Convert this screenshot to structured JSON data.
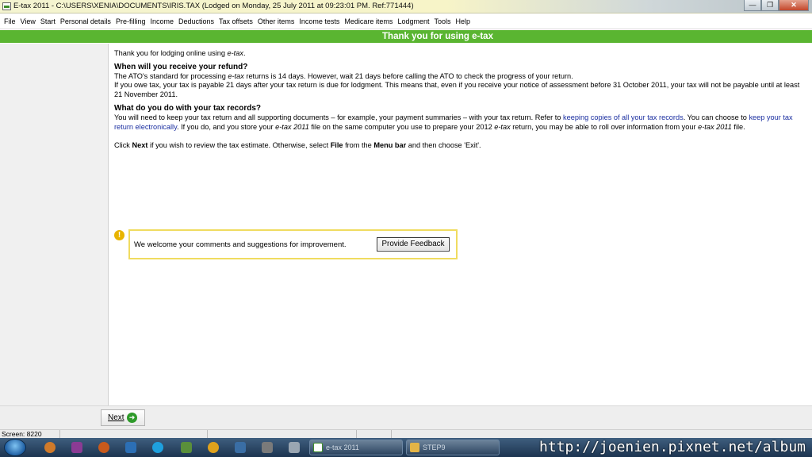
{
  "window": {
    "title": "E-tax 2011 - C:\\USERS\\XENIA\\DOCUMENTS\\IRIS.TAX (Lodged on Monday, 25 July 2011 at 09:23:01 PM.  Ref:771444)",
    "minimize_glyph": "—",
    "maximize_glyph": "❐",
    "close_glyph": "✕"
  },
  "menu": {
    "items": [
      {
        "label": "File"
      },
      {
        "label": "View"
      },
      {
        "label": "Start"
      },
      {
        "label": "Personal details"
      },
      {
        "label": "Pre-filling"
      },
      {
        "label": "Income"
      },
      {
        "label": "Deductions"
      },
      {
        "label": "Tax offsets"
      },
      {
        "label": "Other items"
      },
      {
        "label": "Income tests"
      },
      {
        "label": "Medicare items"
      },
      {
        "label": "Lodgment"
      },
      {
        "label": "Tools"
      },
      {
        "label": "Help"
      }
    ]
  },
  "header": {
    "title": "Thank you for using e-tax",
    "color": "#5ab531"
  },
  "content": {
    "intro_before": "Thank you for lodging online using ",
    "intro_em": "e-tax",
    "intro_after": ".",
    "refund_heading": "When will you receive your refund?",
    "refund_p1_before": "The ATO's standard for processing ",
    "refund_p1_em": "e-tax",
    "refund_p1_after": " returns is 14 days. However, wait 21 days before calling the ATO to check the progress of your return.",
    "refund_p2": "If you owe tax, your tax is payable 21 days after your tax return is due for lodgment. This means that, even if you receive your notice of assessment before 31 October 2011, your tax will not be payable until at least 21 November 2011.",
    "records_heading": "What do you do with your tax records?",
    "records_p_1": "You will need to keep your tax return and all supporting documents – for example, your payment summaries – with your tax return. Refer to ",
    "records_link_1": "keeping copies of all your tax records",
    "records_p_2": ". You can choose to ",
    "records_link_2": "keep your tax return electronically",
    "records_p_3": ". If you do, and you store your ",
    "records_em_1": "e-tax 2011",
    "records_p_4": " file on the same computer you use to prepare your 2012 ",
    "records_em_2": "e-tax",
    "records_p_5": " return, you may be able to roll over information from your ",
    "records_em_3": "e-tax 2011",
    "records_p_6": " file.",
    "next_p_1": "Click ",
    "next_p_b1": "Next",
    "next_p_2": " if you wish to review the tax estimate. Otherwise, select ",
    "next_p_b2": "File",
    "next_p_3": " from the ",
    "next_p_b3": "Menu bar",
    "next_p_4": " and then choose 'Exit'."
  },
  "feedback": {
    "icon": "warning-icon",
    "icon_glyph": "!",
    "text": "We welcome your comments and suggestions for improvement.",
    "button_label": "Provide Feedback",
    "border_color": "#f0dc60"
  },
  "navigation": {
    "next_label": "Next",
    "next_arrow": "➜"
  },
  "status": {
    "screen": "Screen: 8220"
  },
  "taskbar": {
    "tasks": [
      {
        "label": "e-tax 2011"
      },
      {
        "label": "STEP9"
      }
    ],
    "watermark": "http://joenien.pixnet.net/album"
  }
}
